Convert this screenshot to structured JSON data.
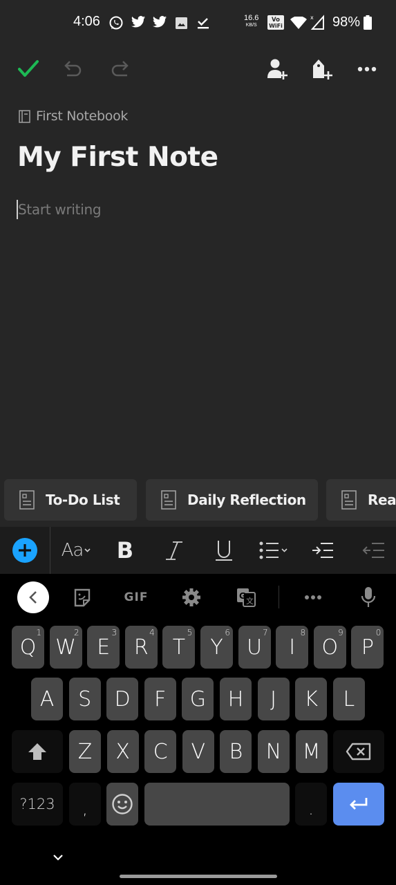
{
  "status_bar": {
    "time": "4:06",
    "notification_icons": [
      "whatsapp-icon",
      "twitter-icon",
      "twitter-icon",
      "gallery-icon",
      "tasks-check-icon"
    ],
    "net_speed_value": "16.6",
    "net_speed_unit": "KB/S",
    "vowifi_label_top": "Vo",
    "vowifi_label_bottom": "WiFi",
    "battery": "98%"
  },
  "toolbar": {
    "done": "done-check-icon",
    "undo": "undo-icon",
    "redo": "redo-icon",
    "share": "add-person-icon",
    "tag": "add-tag-icon",
    "more": "more-icon",
    "accent": "#1db954"
  },
  "note": {
    "notebook": "First Notebook",
    "title": "My First Note",
    "body_placeholder": "Start writing"
  },
  "templates": [
    {
      "label": "To-Do List"
    },
    {
      "label": "Daily Reflection"
    },
    {
      "label": "Reading List"
    }
  ],
  "format_bar": {
    "insert": "insert-plus-icon",
    "text_style": "Aa",
    "bold": "B",
    "italic": "I",
    "underline": "U",
    "accent": "#1aa3ff"
  },
  "keyboard": {
    "suggest_bar": {
      "gif": "GIF"
    },
    "row1": [
      {
        "k": "Q",
        "h": "1"
      },
      {
        "k": "W",
        "h": "2"
      },
      {
        "k": "E",
        "h": "3"
      },
      {
        "k": "R",
        "h": "4"
      },
      {
        "k": "T",
        "h": "5"
      },
      {
        "k": "Y",
        "h": "6"
      },
      {
        "k": "U",
        "h": "7"
      },
      {
        "k": "I",
        "h": "8"
      },
      {
        "k": "O",
        "h": "9"
      },
      {
        "k": "P",
        "h": "0"
      }
    ],
    "row2": [
      "A",
      "S",
      "D",
      "F",
      "G",
      "H",
      "J",
      "K",
      "L"
    ],
    "row3": [
      "Z",
      "X",
      "C",
      "V",
      "B",
      "N",
      "M"
    ],
    "symbols": "?123",
    "comma": ",",
    "period": ".",
    "enter_color": "#5b8def"
  }
}
